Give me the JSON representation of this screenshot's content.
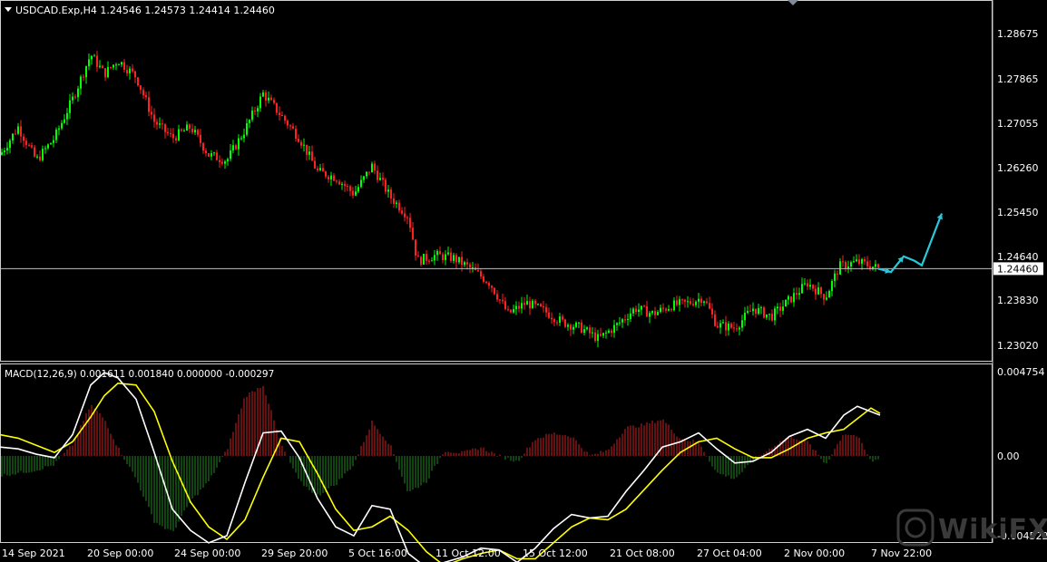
{
  "header": {
    "symbol_line": "USDCAD.Exp,H4  1.24546 1.24573 1.24414 1.24460",
    "dropdown_icon": "triangle-down-icon"
  },
  "price_axis": {
    "labels": [
      "1.28675",
      "1.27865",
      "1.27055",
      "1.26260",
      "1.25450",
      "1.24640",
      "1.23830",
      "1.23020"
    ],
    "current_price": "1.24460",
    "current_price_value": 1.2446
  },
  "macd_panel": {
    "label": "MACD(12,26,9) 0.001611 0.001840 0.000000 -0.000297",
    "axis_labels": [
      "0.004754",
      "0.00",
      "-0.004522"
    ],
    "main_line_color": "#ffffff",
    "signal_line_color": "#ffff00",
    "hist_up_color": "#cc2222",
    "hist_down_color": "#228822"
  },
  "time_axis": {
    "labels": [
      "14 Sep 2021",
      "20 Sep 00:00",
      "24 Sep 00:00",
      "29 Sep 20:00",
      "5 Oct 16:00",
      "11 Oct 12:00",
      "15 Oct 12:00",
      "21 Oct 08:00",
      "27 Oct 04:00",
      "2 Nov 00:00",
      "7 Nov 22:00"
    ]
  },
  "colors": {
    "background": "#000000",
    "bull": "#00ff00",
    "bear": "#ff2020",
    "annotation_arrow": "#29c8d8",
    "grid_text": "#ffffff"
  },
  "watermark": {
    "text": "WikiFX",
    "icon": "wikifx-logo-icon"
  },
  "chart_data": {
    "type": "line",
    "title": "USDCAD.Exp,H4",
    "approx_close_path": [
      [
        0,
        1.265
      ],
      [
        20,
        1.27
      ],
      [
        40,
        1.264
      ],
      [
        60,
        1.268
      ],
      [
        80,
        1.275
      ],
      [
        100,
        1.283
      ],
      [
        115,
        1.2795
      ],
      [
        130,
        1.282
      ],
      [
        150,
        1.279
      ],
      [
        170,
        1.271
      ],
      [
        190,
        1.268
      ],
      [
        210,
        1.27
      ],
      [
        230,
        1.265
      ],
      [
        250,
        1.264
      ],
      [
        270,
        1.2695
      ],
      [
        290,
        1.276
      ],
      [
        310,
        1.272
      ],
      [
        330,
        1.268
      ],
      [
        350,
        1.262
      ],
      [
        370,
        1.261
      ],
      [
        390,
        1.258
      ],
      [
        410,
        1.263
      ],
      [
        430,
        1.2575
      ],
      [
        450,
        1.254
      ],
      [
        460,
        1.246
      ],
      [
        480,
        1.247
      ],
      [
        500,
        1.2465
      ],
      [
        520,
        1.2445
      ],
      [
        540,
        1.242
      ],
      [
        560,
        1.2365
      ],
      [
        580,
        1.2385
      ],
      [
        600,
        1.237
      ],
      [
        620,
        1.235
      ],
      [
        640,
        1.234
      ],
      [
        660,
        1.232
      ],
      [
        680,
        1.2345
      ],
      [
        700,
        1.2375
      ],
      [
        720,
        1.2365
      ],
      [
        740,
        1.238
      ],
      [
        760,
        1.2385
      ],
      [
        775,
        1.2395
      ],
      [
        790,
        1.2345
      ],
      [
        810,
        1.234
      ],
      [
        830,
        1.2375
      ],
      [
        850,
        1.236
      ],
      [
        870,
        1.239
      ],
      [
        890,
        1.242
      ],
      [
        910,
        1.2395
      ],
      [
        925,
        1.245
      ],
      [
        945,
        1.2458
      ],
      [
        970,
        1.2446
      ]
    ],
    "macd_main": [
      [
        0,
        0.0005
      ],
      [
        20,
        0.0004
      ],
      [
        40,
        0.0001
      ],
      [
        60,
        -0.0001
      ],
      [
        80,
        0.0012
      ],
      [
        100,
        0.004
      ],
      [
        115,
        0.0047
      ],
      [
        130,
        0.0044
      ],
      [
        150,
        0.0032
      ],
      [
        170,
        0.0002
      ],
      [
        190,
        -0.003
      ],
      [
        210,
        -0.0042
      ],
      [
        230,
        -0.0049
      ],
      [
        250,
        -0.0045
      ],
      [
        270,
        -0.0015
      ],
      [
        290,
        0.0013
      ],
      [
        310,
        0.0014
      ],
      [
        330,
        -0.0001
      ],
      [
        350,
        -0.0024
      ],
      [
        370,
        -0.004
      ],
      [
        390,
        -0.0045
      ],
      [
        410,
        -0.0028
      ],
      [
        430,
        -0.003
      ],
      [
        450,
        -0.0055
      ],
      [
        470,
        -0.0063
      ],
      [
        490,
        -0.006
      ],
      [
        510,
        -0.0057
      ],
      [
        530,
        -0.0052
      ],
      [
        550,
        -0.0053
      ],
      [
        570,
        -0.006
      ],
      [
        590,
        -0.0052
      ],
      [
        610,
        -0.0041
      ],
      [
        630,
        -0.0033
      ],
      [
        650,
        -0.0035
      ],
      [
        670,
        -0.0034
      ],
      [
        690,
        -0.002
      ],
      [
        710,
        -0.0008
      ],
      [
        730,
        0.0005
      ],
      [
        750,
        0.0008
      ],
      [
        770,
        0.0013
      ],
      [
        790,
        0.0004
      ],
      [
        810,
        -0.0004
      ],
      [
        830,
        -0.0003
      ],
      [
        850,
        0.0002
      ],
      [
        870,
        0.0011
      ],
      [
        890,
        0.0015
      ],
      [
        910,
        0.001
      ],
      [
        930,
        0.0023
      ],
      [
        945,
        0.0028
      ],
      [
        960,
        0.0025
      ],
      [
        970,
        0.0023
      ]
    ],
    "macd_signal": [
      [
        0,
        0.0012
      ],
      [
        20,
        0.001
      ],
      [
        40,
        0.0006
      ],
      [
        60,
        0.0002
      ],
      [
        80,
        0.0008
      ],
      [
        100,
        0.0022
      ],
      [
        115,
        0.0034
      ],
      [
        130,
        0.0041
      ],
      [
        150,
        0.004
      ],
      [
        170,
        0.0025
      ],
      [
        190,
        -0.0003
      ],
      [
        210,
        -0.0026
      ],
      [
        230,
        -0.004
      ],
      [
        250,
        -0.0047
      ],
      [
        270,
        -0.0036
      ],
      [
        290,
        -0.0012
      ],
      [
        310,
        0.001
      ],
      [
        330,
        0.0008
      ],
      [
        350,
        -0.001
      ],
      [
        370,
        -0.003
      ],
      [
        390,
        -0.0042
      ],
      [
        410,
        -0.004
      ],
      [
        430,
        -0.0034
      ],
      [
        450,
        -0.0042
      ],
      [
        470,
        -0.0054
      ],
      [
        490,
        -0.0062
      ],
      [
        510,
        -0.0058
      ],
      [
        530,
        -0.0055
      ],
      [
        550,
        -0.0053
      ],
      [
        570,
        -0.0058
      ],
      [
        590,
        -0.0058
      ],
      [
        610,
        -0.0049
      ],
      [
        630,
        -0.004
      ],
      [
        650,
        -0.0035
      ],
      [
        670,
        -0.0036
      ],
      [
        690,
        -0.003
      ],
      [
        710,
        -0.0019
      ],
      [
        730,
        -0.0008
      ],
      [
        750,
        0.0002
      ],
      [
        770,
        0.0008
      ],
      [
        790,
        0.001
      ],
      [
        810,
        0.0004
      ],
      [
        830,
        -0.0001
      ],
      [
        850,
        -0.0001
      ],
      [
        870,
        0.0004
      ],
      [
        890,
        0.001
      ],
      [
        910,
        0.0013
      ],
      [
        930,
        0.0015
      ],
      [
        945,
        0.0021
      ],
      [
        960,
        0.0027
      ],
      [
        970,
        0.0024
      ]
    ],
    "forecast_arrow_prices": [
      1.2446,
      1.244,
      1.2468,
      1.246,
      1.2452,
      1.2545
    ]
  }
}
